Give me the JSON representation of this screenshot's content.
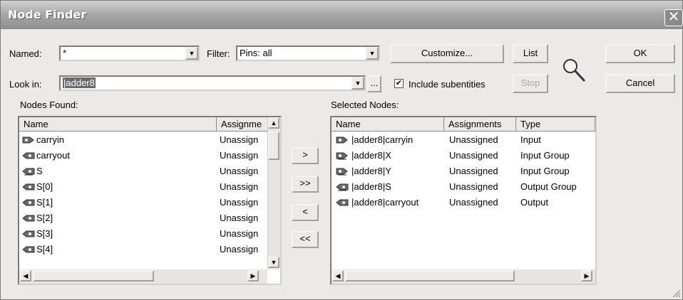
{
  "window": {
    "title": "Node Finder"
  },
  "named": {
    "label": "Named:",
    "value": "*"
  },
  "filter": {
    "label": "Filter:",
    "value": "Pins: all"
  },
  "look_in": {
    "label": "Look in:",
    "value": "|adder8",
    "browse_label": "..."
  },
  "include_subentities": {
    "label": "Include subentities",
    "checked": true,
    "check_glyph": "✔"
  },
  "buttons": {
    "customize": "Customize...",
    "list": "List",
    "stop": "Stop",
    "ok": "OK",
    "cancel": "Cancel",
    "move_right": ">",
    "move_all_right": ">>",
    "move_left": "<",
    "move_all_left": "<<"
  },
  "nodes_found": {
    "label": "Nodes Found:",
    "columns": [
      "Name",
      "Assignme"
    ],
    "rows": [
      {
        "name": "carryin",
        "assignment": "Unassign",
        "icon": "input-pin-icon"
      },
      {
        "name": "carryout",
        "assignment": "Unassign",
        "icon": "output-pin-icon"
      },
      {
        "name": "S",
        "assignment": "Unassign",
        "icon": "output-group-icon"
      },
      {
        "name": "S[0]",
        "assignment": "Unassign",
        "icon": "output-pin-icon"
      },
      {
        "name": "S[1]",
        "assignment": "Unassign",
        "icon": "output-pin-icon"
      },
      {
        "name": "S[2]",
        "assignment": "Unassign",
        "icon": "output-pin-icon"
      },
      {
        "name": "S[3]",
        "assignment": "Unassign",
        "icon": "output-pin-icon"
      },
      {
        "name": "S[4]",
        "assignment": "Unassign",
        "icon": "output-pin-icon"
      }
    ]
  },
  "selected_nodes": {
    "label": "Selected Nodes:",
    "columns": [
      "Name",
      "Assignments",
      "Type"
    ],
    "rows": [
      {
        "name": "|adder8|carryin",
        "assignment": "Unassigned",
        "type": "Input",
        "icon": "input-pin-icon"
      },
      {
        "name": "|adder8|X",
        "assignment": "Unassigned",
        "type": "Input Group",
        "icon": "input-group-icon"
      },
      {
        "name": "|adder8|Y",
        "assignment": "Unassigned",
        "type": "Input Group",
        "icon": "input-group-icon"
      },
      {
        "name": "|adder8|S",
        "assignment": "Unassigned",
        "type": "Output Group",
        "icon": "output-group-icon"
      },
      {
        "name": "|adder8|carryout",
        "assignment": "Unassigned",
        "type": "Output",
        "icon": "output-pin-icon"
      }
    ]
  },
  "icons": {
    "close": "close-icon",
    "search": "magnifier-icon",
    "dropdown": "▼",
    "scroll_up": "▲",
    "scroll_down": "▼",
    "scroll_left": "◀",
    "scroll_right": "▶",
    "close_glyph": "✕"
  }
}
